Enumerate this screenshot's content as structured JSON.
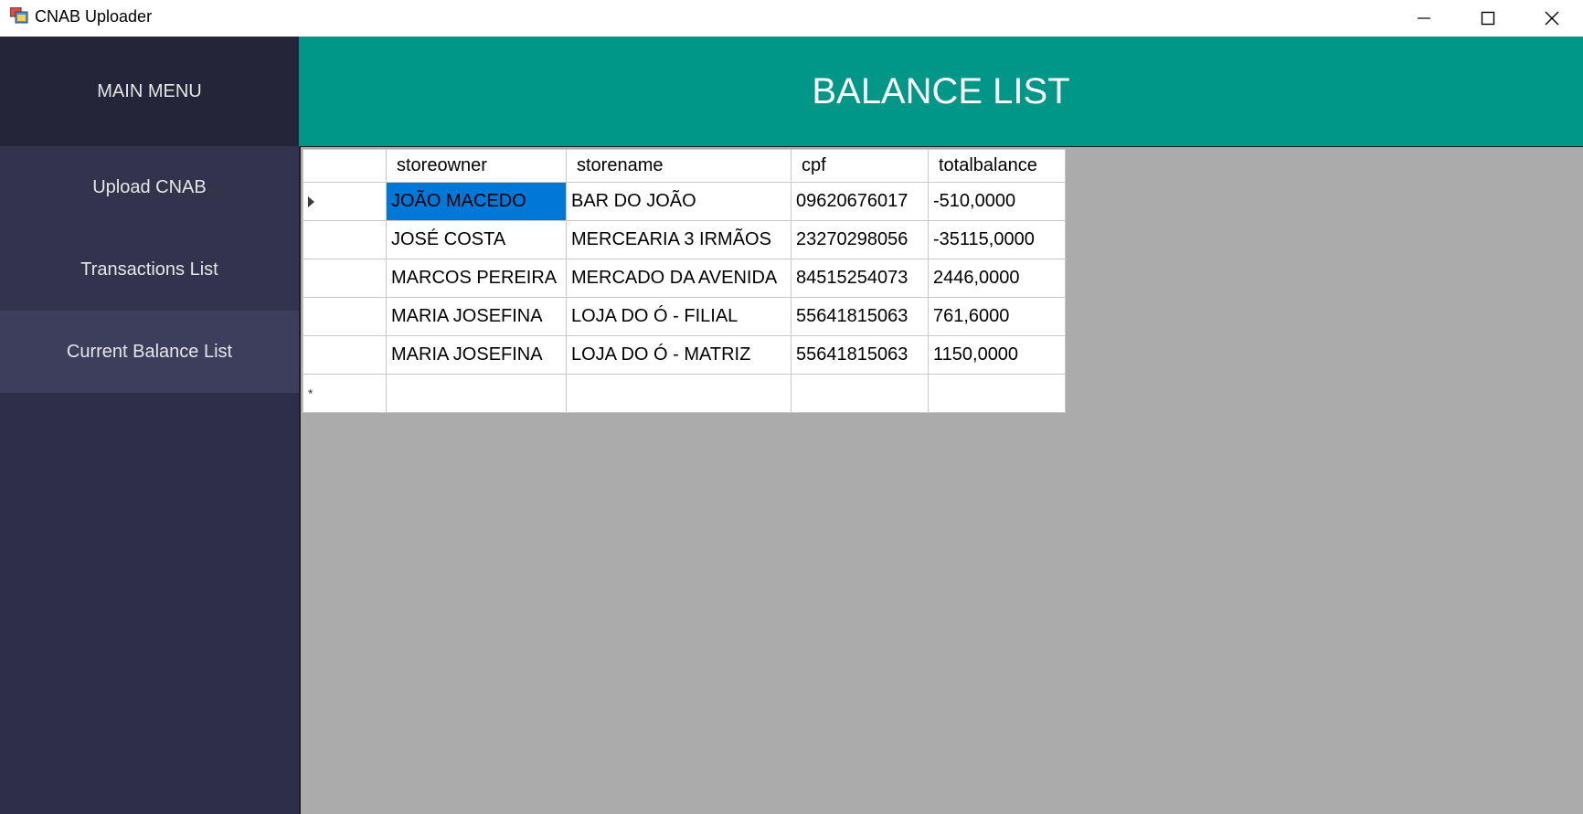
{
  "window": {
    "title": "CNAB Uploader",
    "icon": "app-window-icon",
    "controls": [
      "minimize-icon",
      "maximize-icon",
      "close-icon"
    ]
  },
  "sidebar": {
    "header": "MAIN MENU",
    "items": [
      {
        "label": "Upload CNAB",
        "active": false
      },
      {
        "label": "Transactions List",
        "active": false
      },
      {
        "label": "Current Balance List",
        "active": true
      }
    ]
  },
  "main": {
    "title": "BALANCE LIST"
  },
  "grid": {
    "columns": [
      "storeowner",
      "storename",
      "cpf",
      "totalbalance"
    ],
    "rows": [
      {
        "storeowner": "JOÃO MACEDO",
        "storename": "BAR DO JOÃO",
        "cpf": "09620676017",
        "totalbalance": "-510,0000"
      },
      {
        "storeowner": "JOSÉ COSTA",
        "storename": "MERCEARIA 3 IRMÃOS",
        "cpf": "23270298056",
        "totalbalance": "-35115,0000"
      },
      {
        "storeowner": "MARCOS PEREIRA",
        "storename": "MERCADO DA AVENIDA",
        "cpf": "84515254073",
        "totalbalance": "2446,0000"
      },
      {
        "storeowner": "MARIA JOSEFINA",
        "storename": "LOJA DO Ó - FILIAL",
        "cpf": "55641815063",
        "totalbalance": "761,6000"
      },
      {
        "storeowner": "MARIA JOSEFINA",
        "storename": "LOJA DO Ó - MATRIZ",
        "cpf": "55641815063",
        "totalbalance": "1150,0000"
      }
    ],
    "new_row_marker": "*",
    "selected_row": 0,
    "selected_column": "storeowner"
  },
  "colors": {
    "header_teal": "#009688",
    "sidebar_bg": "#2e2e48",
    "sidebar_header_bg": "#25253a",
    "sidebar_active_bg": "#3d3d5c",
    "grid_background": "#ababab",
    "selection": "#0078d7"
  }
}
